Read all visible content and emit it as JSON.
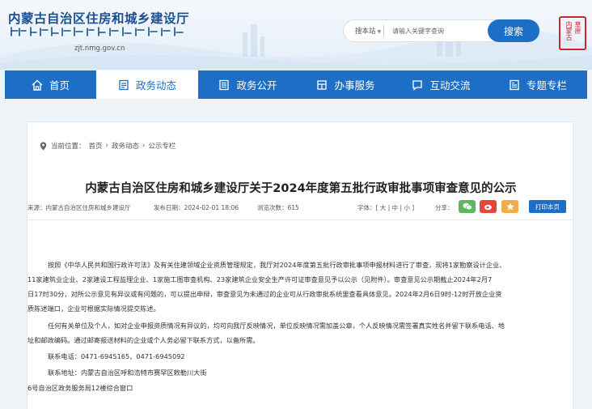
{
  "header": {
    "site_name": "内蒙古自治区住房和城乡建设厅",
    "domain": "zjt.nmg.gov.cn",
    "search_scope": "搜本站",
    "search_placeholder": "请输入关键字查询",
    "search_button": "搜索",
    "seal_col1": "内蒙古",
    "seal_col2": "草原"
  },
  "nav": {
    "items": [
      {
        "label": "首页",
        "icon": "home-icon"
      },
      {
        "label": "政务动态",
        "icon": "document-icon"
      },
      {
        "label": "政务公开",
        "icon": "list-icon"
      },
      {
        "label": "办事服务",
        "icon": "building-icon"
      },
      {
        "label": "互动交流",
        "icon": "chat-icon"
      },
      {
        "label": "专题专栏",
        "icon": "topic-icon"
      }
    ],
    "active": "政务动态"
  },
  "breadcrumb": {
    "prefix": "当前位置：",
    "items": [
      "首页",
      "政务动态",
      "公示专栏"
    ],
    "sep": "›"
  },
  "article": {
    "title": "内蒙古自治区住房和城乡建设厅关于2024年度第五批行政审批事项审查意见的公示",
    "source": "来源：内蒙古自治区住房和城乡建设厅",
    "published": "发布日期：2024-02-01 18:06",
    "views": "浏览次数：615",
    "font_label": "字体：",
    "font_sizes": "[ 大 | 中 | 小 ]",
    "share_label": "分享：",
    "print": "打印本页",
    "lines": [
      "按照《中华人民共和国行政许可法》及有关住建领域企业资质管理规定，我厅对2024年度第五批行政审批事项申报材料进行了审查，现将1家勘察设计企业、",
      "11家建筑业企业、2家建设工程监理企业、1家施工图审查机构、23家建筑企业安全生产许可证审查意见予以公示（见附件）。审查意见公示期截止2024年2月7",
      "日17时30分，对所公示意见有异议或有问题的，可以提出申辩，审查意见为未通过的企业可从行政审批系统里查看具体意见。2024年2月6日9时-12时开放企业资",
      "质陈述端口，企业可根据实际情况提交陈述。",
      "任何有关单位及个人，如对企业申报资质情况有异议的，均可向我厅反映情况，单位反映情况需加盖公章，个人反映情况需签署真实姓名并留下联系电话、地",
      "址和邮政编码。通过邮寄报送材料的企业或个人务必留下联系方式，以备所需。",
      "联系电话：0471-6945165、0471-6945092",
      "联系地址：内蒙古自治区呼和浩特市赛罕区敕勒川大街",
      "6号自治区政务服务局12楼综合窗口"
    ]
  },
  "colors": {
    "brand_blue": "#1c6fc4",
    "wechat_green": "#5cb85c",
    "weibo_red": "#e6453a",
    "favorite_yellow": "#f0ad4e"
  }
}
